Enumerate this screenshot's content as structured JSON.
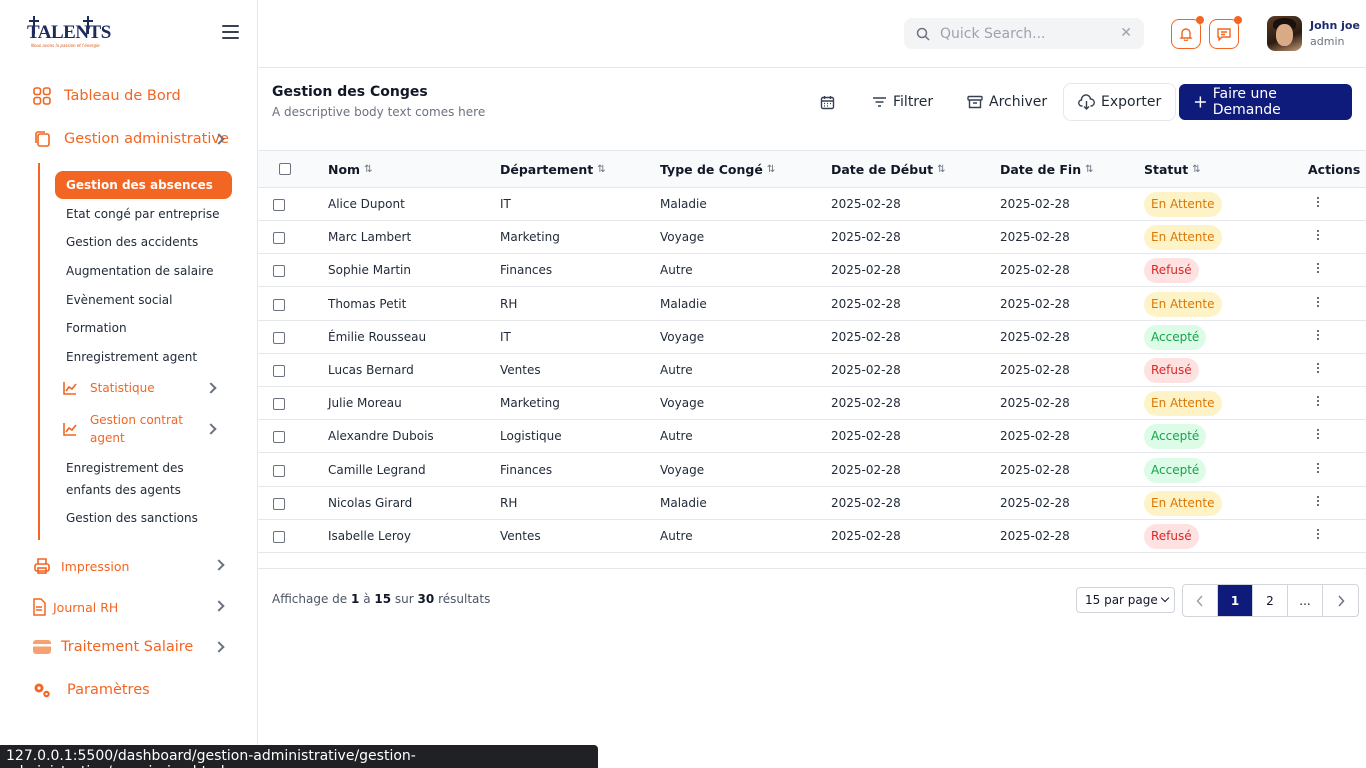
{
  "brand": {
    "name": "TALENTS",
    "tagline": "Nous avons la passion et l'énergie",
    "region": "Afrique"
  },
  "sidebar": {
    "tableau": "Tableau de Bord",
    "gestion_admin": "Gestion administrative",
    "sub_active": "Gestion des absences",
    "subs": [
      "Etat congé par entreprise",
      "Gestion des accidents",
      "Augmentation de salaire",
      "Evènement social",
      "Formation",
      "Enregistrement agent"
    ],
    "statistique": "Statistique",
    "contrat_line1": "Gestion contrat",
    "contrat_line2": "agent",
    "enfants_line1": "Enregistrement des",
    "enfants_line2": "enfants des agents",
    "sanctions": "Gestion des sanctions",
    "impression": "Impression",
    "journal": "Journal RH",
    "traitement": "Traitement Salaire",
    "parametres": "Paramètres"
  },
  "header": {
    "search_placeholder": "Quick Search...",
    "user_name": "John joe",
    "user_role": "admin"
  },
  "page": {
    "title": "Gestion des Conges",
    "subtitle": "A descriptive body text comes here",
    "filter_label": "Filtrer",
    "archive_label": "Archiver",
    "export_label": "Exporter",
    "primary_label": "Faire une Demande"
  },
  "table": {
    "columns": [
      "Nom",
      "Département",
      "Type de Congé",
      "Date de Début",
      "Date de Fin",
      "Statut",
      "Actions"
    ],
    "rows": [
      [
        "Alice Dupont",
        "IT",
        "Maladie",
        "2025-02-28",
        "2025-02-28",
        "En Attente"
      ],
      [
        "Marc Lambert",
        "Marketing",
        "Voyage",
        "2025-02-28",
        "2025-02-28",
        "En Attente"
      ],
      [
        "Sophie Martin",
        "Finances",
        "Autre",
        "2025-02-28",
        "2025-02-28",
        "Refusé"
      ],
      [
        "Thomas Petit",
        "RH",
        "Maladie",
        "2025-02-28",
        "2025-02-28",
        "En Attente"
      ],
      [
        "Émilie Rousseau",
        "IT",
        "Voyage",
        "2025-02-28",
        "2025-02-28",
        "Accepté"
      ],
      [
        "Lucas Bernard",
        "Ventes",
        "Autre",
        "2025-02-28",
        "2025-02-28",
        "Refusé"
      ],
      [
        "Julie Moreau",
        "Marketing",
        "Voyage",
        "2025-02-28",
        "2025-02-28",
        "En Attente"
      ],
      [
        "Alexandre Dubois",
        "Logistique",
        "Autre",
        "2025-02-28",
        "2025-02-28",
        "Accepté"
      ],
      [
        "Camille Legrand",
        "Finances",
        "Voyage",
        "2025-02-28",
        "2025-02-28",
        "Accepté"
      ],
      [
        "Nicolas Girard",
        "RH",
        "Maladie",
        "2025-02-28",
        "2025-02-28",
        "En Attente"
      ],
      [
        "Isabelle Leroy",
        "Ventes",
        "Autre",
        "2025-02-28",
        "2025-02-28",
        "Refusé"
      ]
    ],
    "status_colors": {
      "En Attente": {
        "bg": "#fef3c7",
        "fg": "#d97706"
      },
      "Refusé": {
        "bg": "#fee2e2",
        "fg": "#dc2626"
      },
      "Accepté": {
        "bg": "#dcfce7",
        "fg": "#16a34a"
      }
    }
  },
  "pagination": {
    "summary_prefix": "Affichage de",
    "from": "1",
    "to_word": "à",
    "to": "15",
    "of_word": "sur",
    "total": "30",
    "suffix": "résultats",
    "per_page": "15 par page",
    "pages": [
      "1",
      "2",
      "..."
    ]
  },
  "status_url": "127.0.0.1:5500/dashboard/gestion-administrative/gestion-administrative/permission.html",
  "colors": {
    "accent": "#f26522",
    "primary": "#0f1b7a"
  }
}
